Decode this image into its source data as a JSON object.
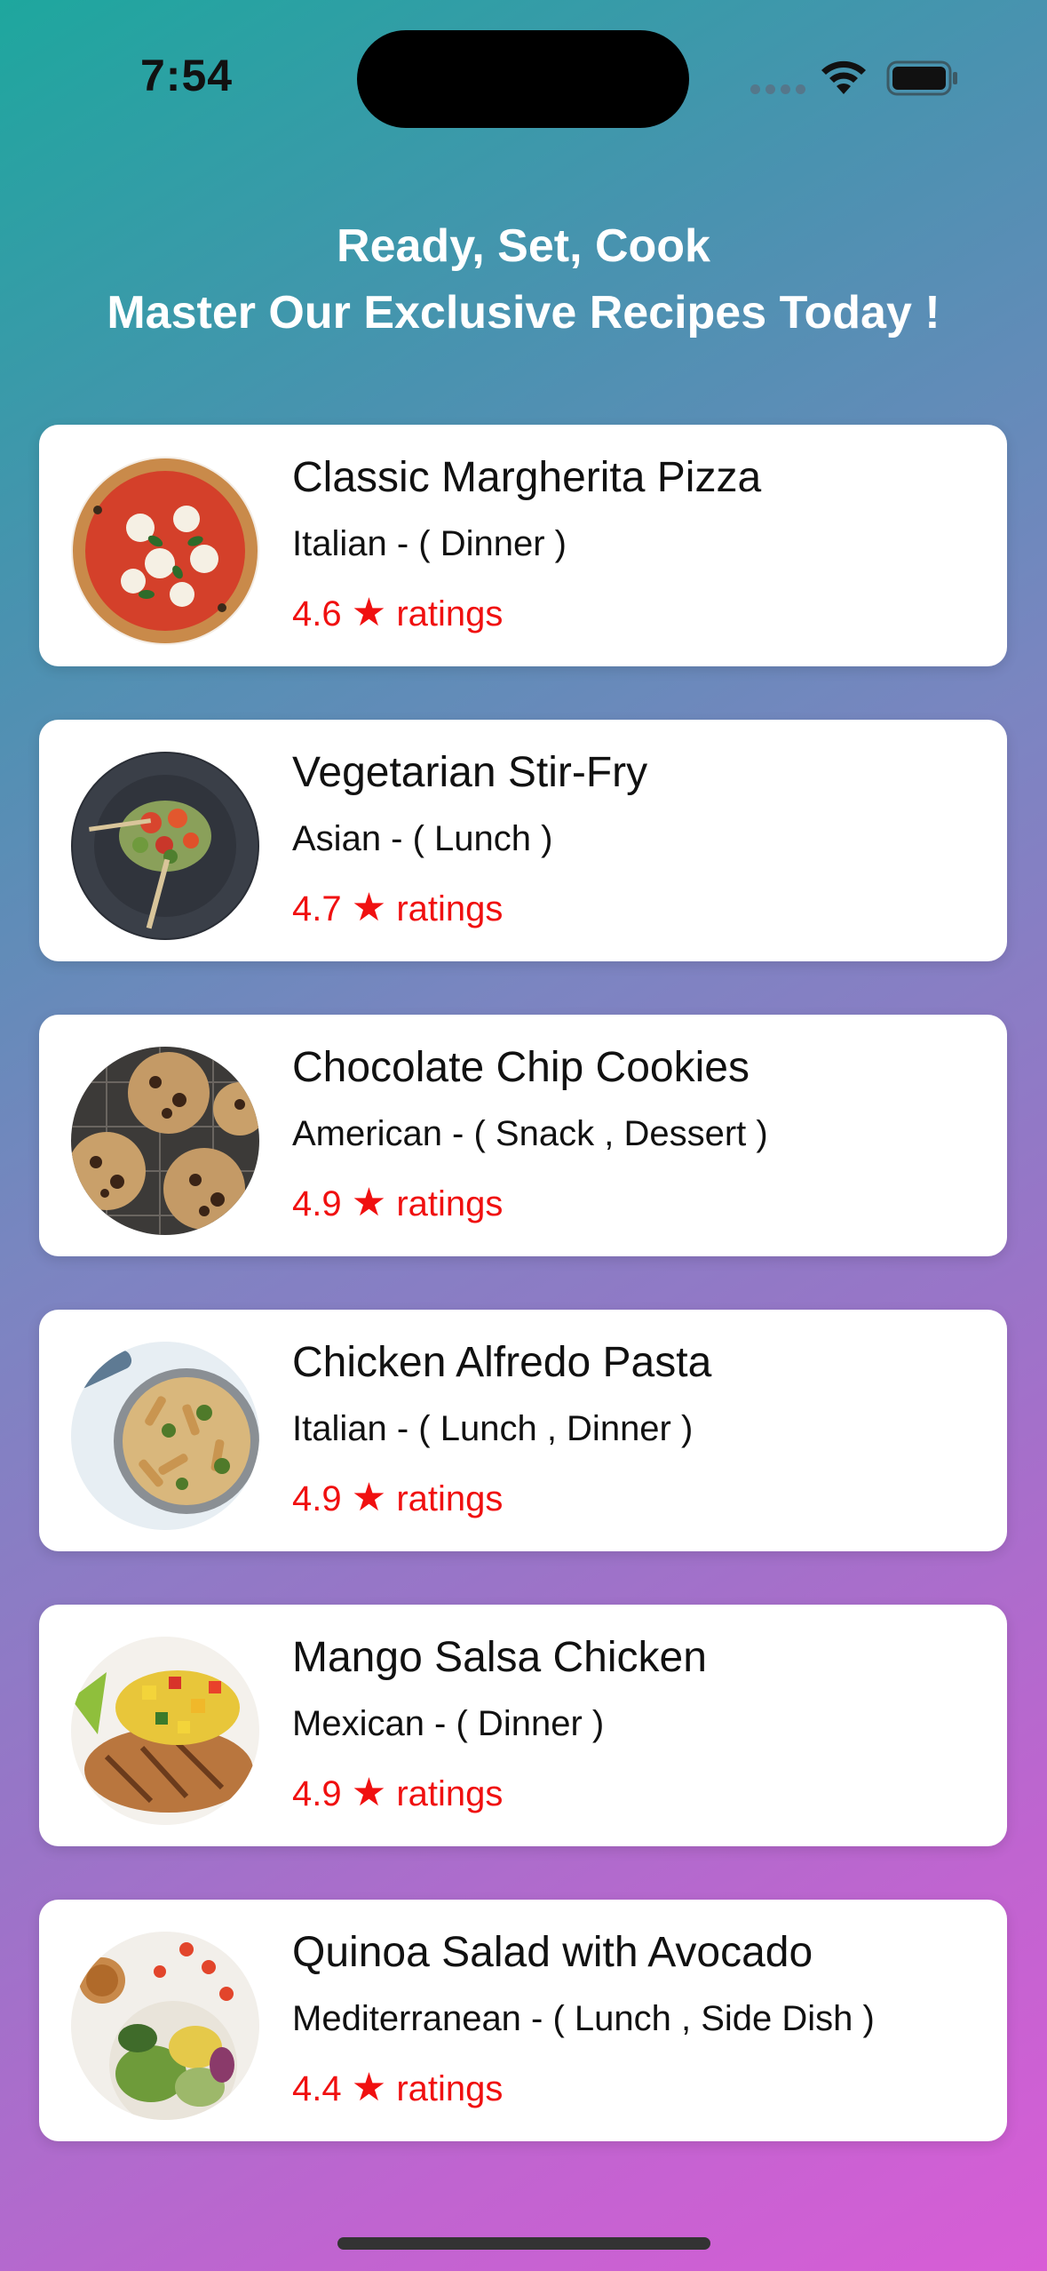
{
  "status_bar": {
    "time": "7:54"
  },
  "header": {
    "line1": "Ready, Set, Cook",
    "line2": "Master Our Exclusive Recipes Today !"
  },
  "recipes": [
    {
      "name": "Classic Margherita Pizza",
      "meta": "Italian - ( Dinner )",
      "rating": "4.6",
      "rating_suffix": "ratings",
      "image_icon": "pizza"
    },
    {
      "name": "Vegetarian Stir-Fry",
      "meta": "Asian - ( Lunch )",
      "rating": "4.7",
      "rating_suffix": "ratings",
      "image_icon": "stir-fry-wok"
    },
    {
      "name": "Chocolate Chip Cookies",
      "meta": "American - ( Snack , Dessert )",
      "rating": "4.9",
      "rating_suffix": "ratings",
      "image_icon": "cookies"
    },
    {
      "name": "Chicken Alfredo Pasta",
      "meta": "Italian - ( Lunch , Dinner )",
      "rating": "4.9",
      "rating_suffix": "ratings",
      "image_icon": "pasta-bowl"
    },
    {
      "name": "Mango Salsa Chicken",
      "meta": "Mexican - ( Dinner )",
      "rating": "4.9",
      "rating_suffix": "ratings",
      "image_icon": "grilled-chicken"
    },
    {
      "name": "Quinoa Salad with Avocado",
      "meta": "Mediterranean - ( Lunch , Side Dish )",
      "rating": "4.4",
      "rating_suffix": "ratings",
      "image_icon": "salad-bowl"
    }
  ],
  "colors": {
    "rating": "#f01010",
    "gradient_start": "#1ea79e",
    "gradient_end": "#d85dd6"
  }
}
